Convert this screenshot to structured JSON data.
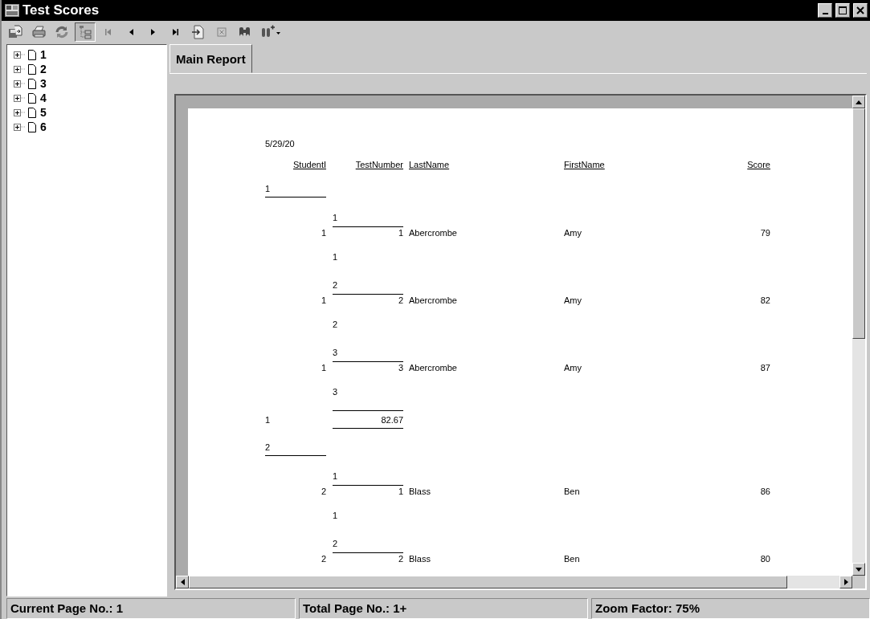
{
  "window": {
    "title": "Test Scores"
  },
  "toolbar": [
    {
      "kind": "export",
      "disabled": false,
      "pressed": false
    },
    {
      "kind": "print",
      "disabled": false,
      "pressed": false
    },
    {
      "kind": "refresh",
      "disabled": false,
      "pressed": false
    },
    {
      "kind": "tree",
      "disabled": false,
      "pressed": true
    },
    {
      "kind": "first",
      "disabled": true,
      "pressed": false
    },
    {
      "kind": "prev",
      "disabled": false,
      "pressed": false
    },
    {
      "kind": "next",
      "disabled": false,
      "pressed": false
    },
    {
      "kind": "last",
      "disabled": false,
      "pressed": false
    },
    {
      "kind": "goto",
      "disabled": false,
      "pressed": false
    },
    {
      "kind": "stop",
      "disabled": true,
      "pressed": false
    },
    {
      "kind": "search",
      "disabled": false,
      "pressed": false
    },
    {
      "kind": "zoom",
      "disabled": false,
      "pressed": false
    }
  ],
  "tree": [
    {
      "label": "1",
      "expanded": false
    },
    {
      "label": "2",
      "expanded": false
    },
    {
      "label": "3",
      "expanded": false
    },
    {
      "label": "4",
      "expanded": false
    },
    {
      "label": "5",
      "expanded": false
    },
    {
      "label": "6",
      "expanded": false
    }
  ],
  "tabs": [
    {
      "label": "Main Report",
      "selected": true
    }
  ],
  "report": {
    "date": "5/29/20",
    "headers": [
      "StudentI",
      "TestNumber",
      "LastName",
      "FirstName",
      "Score"
    ],
    "sections": [
      {
        "kind": "group",
        "value": "1"
      },
      {
        "kind": "record",
        "label": "1",
        "student": "1",
        "test": "1",
        "last": "Abercrombe",
        "first": "Amy",
        "score": "79",
        "footer": "1"
      },
      {
        "kind": "record",
        "label": "2",
        "student": "1",
        "test": "2",
        "last": "Abercrombe",
        "first": "Amy",
        "score": "82",
        "footer": "2"
      },
      {
        "kind": "record",
        "label": "3",
        "student": "1",
        "test": "3",
        "last": "Abercrombe",
        "first": "Amy",
        "score": "87",
        "footer": "3"
      },
      {
        "kind": "summary",
        "student": "1",
        "average": "82.67"
      },
      {
        "kind": "group",
        "value": "2"
      },
      {
        "kind": "record",
        "label": "1",
        "student": "2",
        "test": "1",
        "last": "Blass",
        "first": "Ben",
        "score": "86",
        "footer": "1"
      },
      {
        "kind": "record",
        "label": "2",
        "student": "2",
        "test": "2",
        "last": "Blass",
        "first": "Ben",
        "score": "80"
      }
    ]
  },
  "status_bar": [
    "Current Page No.: 1",
    "Total Page No.: 1+",
    "Zoom Factor: 75%"
  ]
}
